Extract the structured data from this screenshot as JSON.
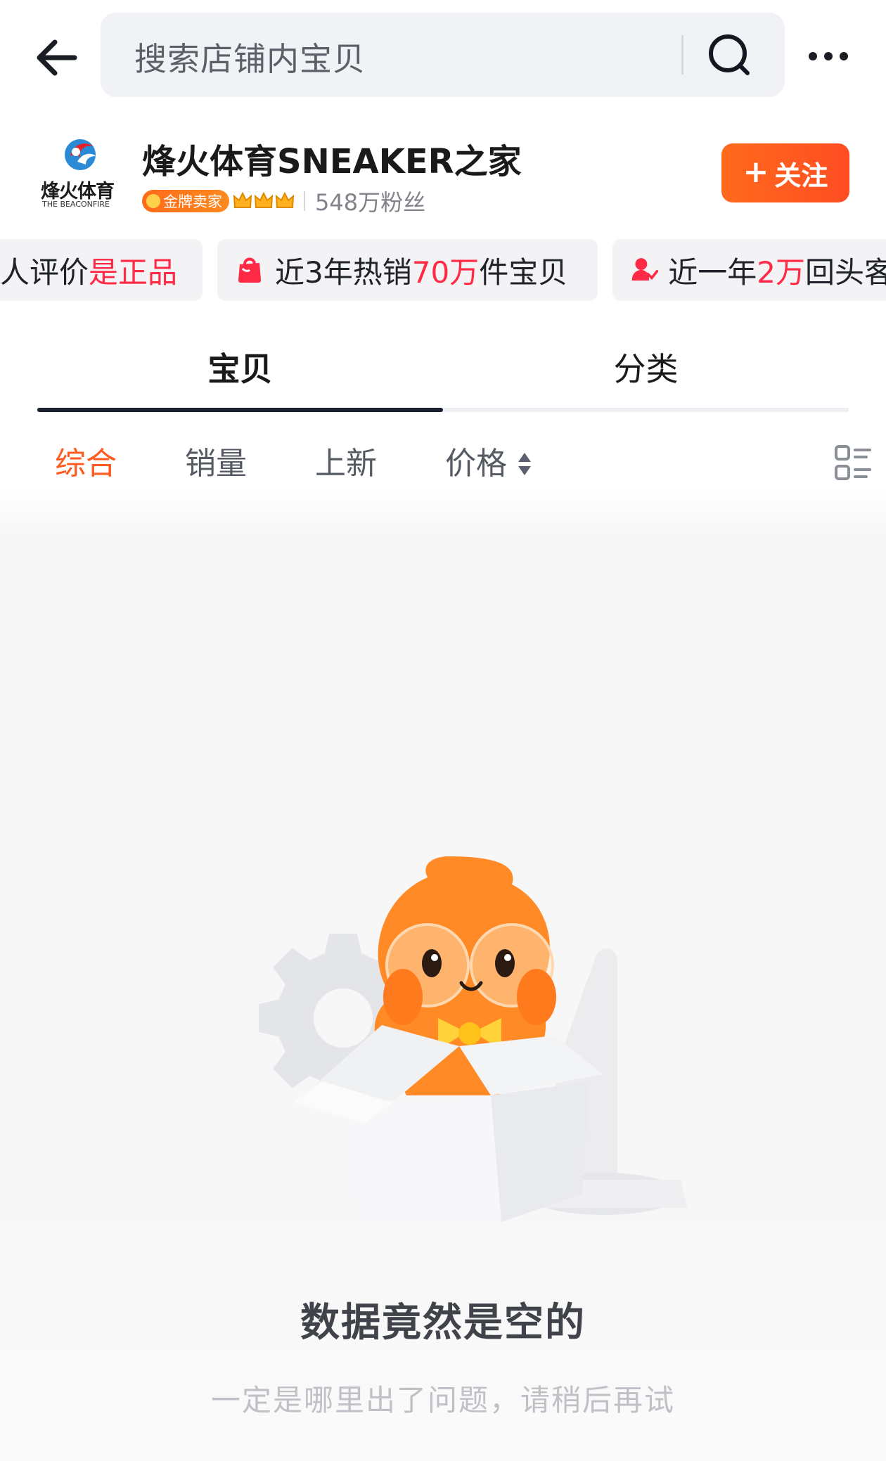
{
  "header": {
    "search_placeholder": "搜索店铺内宝贝"
  },
  "shop": {
    "logo_text": "烽火体育",
    "logo_subtext": "THE BEACONFIRE",
    "name": "烽火体育SNEAKER之家",
    "badge_label": "金牌卖家",
    "crown_count": 3,
    "fans": "548万粉丝",
    "follow_label": "关注",
    "follow_plus": "+"
  },
  "highlights": [
    {
      "prefix": "人评价",
      "accent": "是正品",
      "suffix": ""
    },
    {
      "prefix": "近3年热销",
      "accent": "70万",
      "suffix": "件宝贝"
    },
    {
      "prefix": "近一年",
      "accent": "2万",
      "suffix": "回头客"
    }
  ],
  "tabs": [
    {
      "label": "宝贝",
      "active": true
    },
    {
      "label": "分类",
      "active": false
    }
  ],
  "sort": [
    {
      "label": "综合",
      "active": true
    },
    {
      "label": "销量",
      "active": false
    },
    {
      "label": "上新",
      "active": false
    },
    {
      "label": "价格",
      "active": false
    }
  ],
  "empty_state": {
    "title": "数据竟然是空的",
    "subtitle": "一定是哪里出了问题，请稍后再试"
  },
  "colors": {
    "accent_orange": "#ff5a1f",
    "accent_red": "#ff2a45",
    "follow_button": "#ff5a20"
  },
  "icons": {
    "back": "back-arrow-icon",
    "search": "search-icon",
    "more": "more-icon",
    "layout": "grid-list-toggle-icon"
  }
}
